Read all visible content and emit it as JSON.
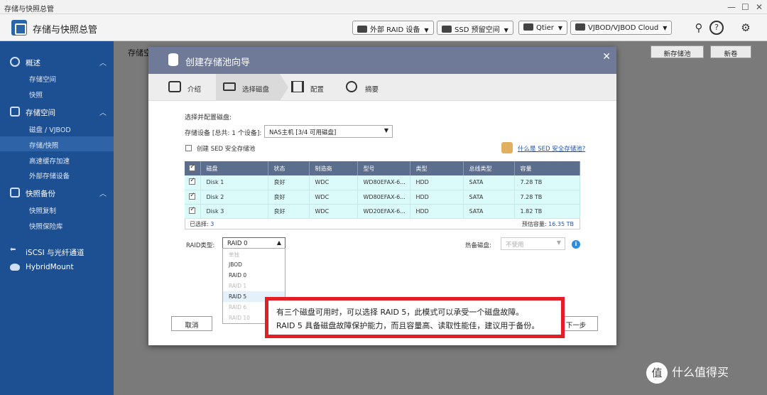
{
  "window": {
    "title": "存储与快照总管",
    "controls": [
      "—",
      "☐",
      "✕"
    ]
  },
  "app": {
    "title": "存储与快照总管",
    "buttons": [
      {
        "label": "外部 RAID 设备",
        "icon": "external-raid-icon"
      },
      {
        "label": "SSD 预留空间",
        "icon": "ssd-icon"
      },
      {
        "label": "Qtier",
        "icon": "qtier-icon"
      },
      {
        "label": "VJBOD/VJBOD Cloud",
        "icon": "vjbod-icon"
      }
    ],
    "icons": [
      "search-settings-icon",
      "help-icon",
      "gear-icon"
    ]
  },
  "sidebar": {
    "sections": [
      {
        "label": "概述",
        "icon": "dashboard-icon",
        "items": [
          "存储空间",
          "快照"
        ]
      },
      {
        "label": "存储空间",
        "icon": "storage-icon",
        "items": [
          "磁盘 / VJBOD",
          "存储/快照",
          "高速缓存加速",
          "外部存储设备"
        ],
        "active": "存储/快照"
      },
      {
        "label": "快照备份",
        "icon": "snapshot-backup-icon",
        "items": [
          "快照复制",
          "快照保险库"
        ]
      },
      {
        "label": "iSCSI 与光纤通道",
        "icon": "iscsi-icon",
        "items": []
      },
      {
        "label": "HybridMount",
        "icon": "hybridmount-icon",
        "items": []
      }
    ]
  },
  "content": {
    "page_title": "存储空",
    "toolbar": {
      "new_pool": "新存储池",
      "new_volume": "新卷"
    }
  },
  "dialog": {
    "title": "创建存储池向导",
    "close": "✕",
    "steps": [
      {
        "label": "介绍",
        "icon": "intro-icon"
      },
      {
        "label": "选择磁盘",
        "icon": "disk-select-icon"
      },
      {
        "label": "配置",
        "icon": "config-icon"
      },
      {
        "label": "摘要",
        "icon": "summary-icon"
      }
    ],
    "active_step": 1,
    "section_label": "选择并配置磁盘:",
    "device_label": "存储设备 [总共: 1 个设备]:",
    "device_value": "NAS主机 [3/4 可用磁盘]",
    "sed_checkbox": "创建 SED 安全存储池",
    "sed_link": "什么是 SED 安全存储池?",
    "table": {
      "headers": [
        "磁盘",
        "状态",
        "制造商",
        "型号",
        "类型",
        "总线类型",
        "容量"
      ],
      "rows": [
        {
          "checked": true,
          "cells": [
            "Disk 1",
            "良好",
            "WDC",
            "WD80EFAX-6...",
            "HDD",
            "SATA",
            "7.28 TB"
          ]
        },
        {
          "checked": true,
          "cells": [
            "Disk 2",
            "良好",
            "WDC",
            "WD80EFAX-6...",
            "HDD",
            "SATA",
            "7.28 TB"
          ]
        },
        {
          "checked": true,
          "cells": [
            "Disk 3",
            "良好",
            "WDC",
            "WD20EFAX-6...",
            "HDD",
            "SATA",
            "1.82 TB"
          ]
        }
      ],
      "selected_label": "已选择:",
      "selected_count": "3",
      "estimated_label": "预估容量:",
      "estimated_value": "16.35 TB"
    },
    "raid": {
      "label": "RAID类型:",
      "value": "RAID 0",
      "options": [
        {
          "label": "单独",
          "disabled": true
        },
        {
          "label": "JBOD",
          "disabled": false
        },
        {
          "label": "RAID 0",
          "disabled": false
        },
        {
          "label": "RAID 1",
          "disabled": true
        },
        {
          "label": "RAID 5",
          "disabled": false,
          "highlight": true
        },
        {
          "label": "RAID 6",
          "disabled": true
        },
        {
          "label": "RAID 10",
          "disabled": true
        }
      ]
    },
    "hot_spare": {
      "label": "热备磁盘:",
      "value": "不使用"
    },
    "info": "i",
    "cancel": "取消",
    "next": "下一步"
  },
  "annotation": {
    "line1": "有三个磁盘可用时，可以选择 RAID 5，此模式可以承受一个磁盘故障。",
    "line2": "RAID 5 具备磁盘故障保护能力，而且容量高、读取性能佳，建议用于备份。"
  },
  "watermark": {
    "badge": "值",
    "text": "什么值得买"
  }
}
